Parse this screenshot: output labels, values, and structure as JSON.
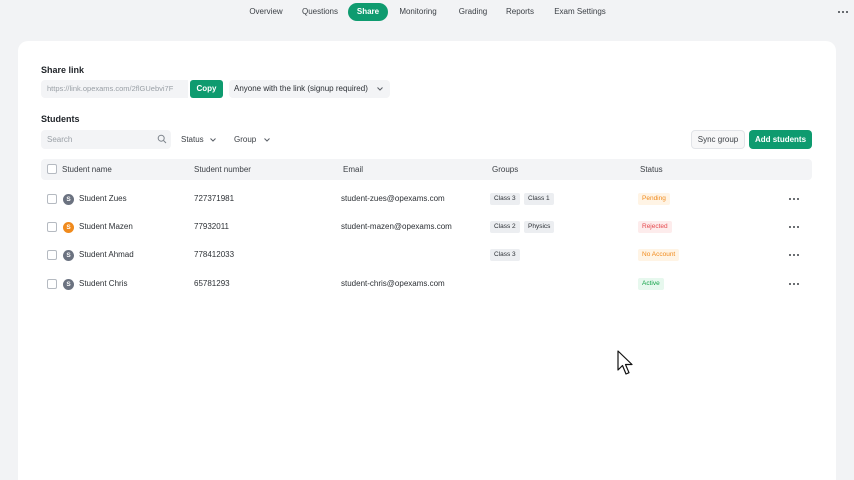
{
  "nav": {
    "tabs": [
      {
        "label": "Overview",
        "active": false
      },
      {
        "label": "Questions",
        "active": false
      },
      {
        "label": "Share",
        "active": true
      },
      {
        "label": "Monitoring",
        "active": false
      },
      {
        "label": "Grading",
        "active": false
      },
      {
        "label": "Reports",
        "active": false
      },
      {
        "label": "Exam Settings",
        "active": false
      }
    ],
    "more_icon": "more-horizontal-icon"
  },
  "share": {
    "title": "Share link",
    "link_value": "https://link.opexams.com/2flGUebvi7F",
    "copy_label": "Copy",
    "access_value": "Anyone with the link (signup required)"
  },
  "students": {
    "title": "Students",
    "search_placeholder": "Search",
    "status_filter": "Status",
    "group_filter": "Group",
    "sync_label": "Sync group",
    "add_label": "Add students",
    "columns": [
      "Student name",
      "Student number",
      "Email",
      "Groups",
      "Status"
    ],
    "rows": [
      {
        "initial": "S",
        "name": "Student Zues",
        "number": "727371981",
        "email": "student-zues@opexams.com",
        "groups": [
          "Class 3",
          "Class 1"
        ],
        "status": "Pending",
        "avatar_color": "#6b7280"
      },
      {
        "initial": "S",
        "name": "Student Mazen",
        "number": "77932011",
        "email": "student-mazen@opexams.com",
        "groups": [
          "Class 2",
          "Physics"
        ],
        "status": "Rejected",
        "avatar_color": "#f08a1c"
      },
      {
        "initial": "S",
        "name": "Student Ahmad",
        "number": "778412033",
        "email": "",
        "groups": [
          "Class 3"
        ],
        "status": "No Account",
        "avatar_color": "#6b7280"
      },
      {
        "initial": "S",
        "name": "Student Chris",
        "number": "65781293",
        "email": "student-chris@opexams.com",
        "groups": [],
        "status": "Active",
        "avatar_color": "#6b7280"
      }
    ]
  },
  "colors": {
    "accent": "#0e9b6f",
    "pending": "#f08a1c",
    "rejected": "#e5484d",
    "no_account": "#f08a1c",
    "active": "#16a34a"
  }
}
